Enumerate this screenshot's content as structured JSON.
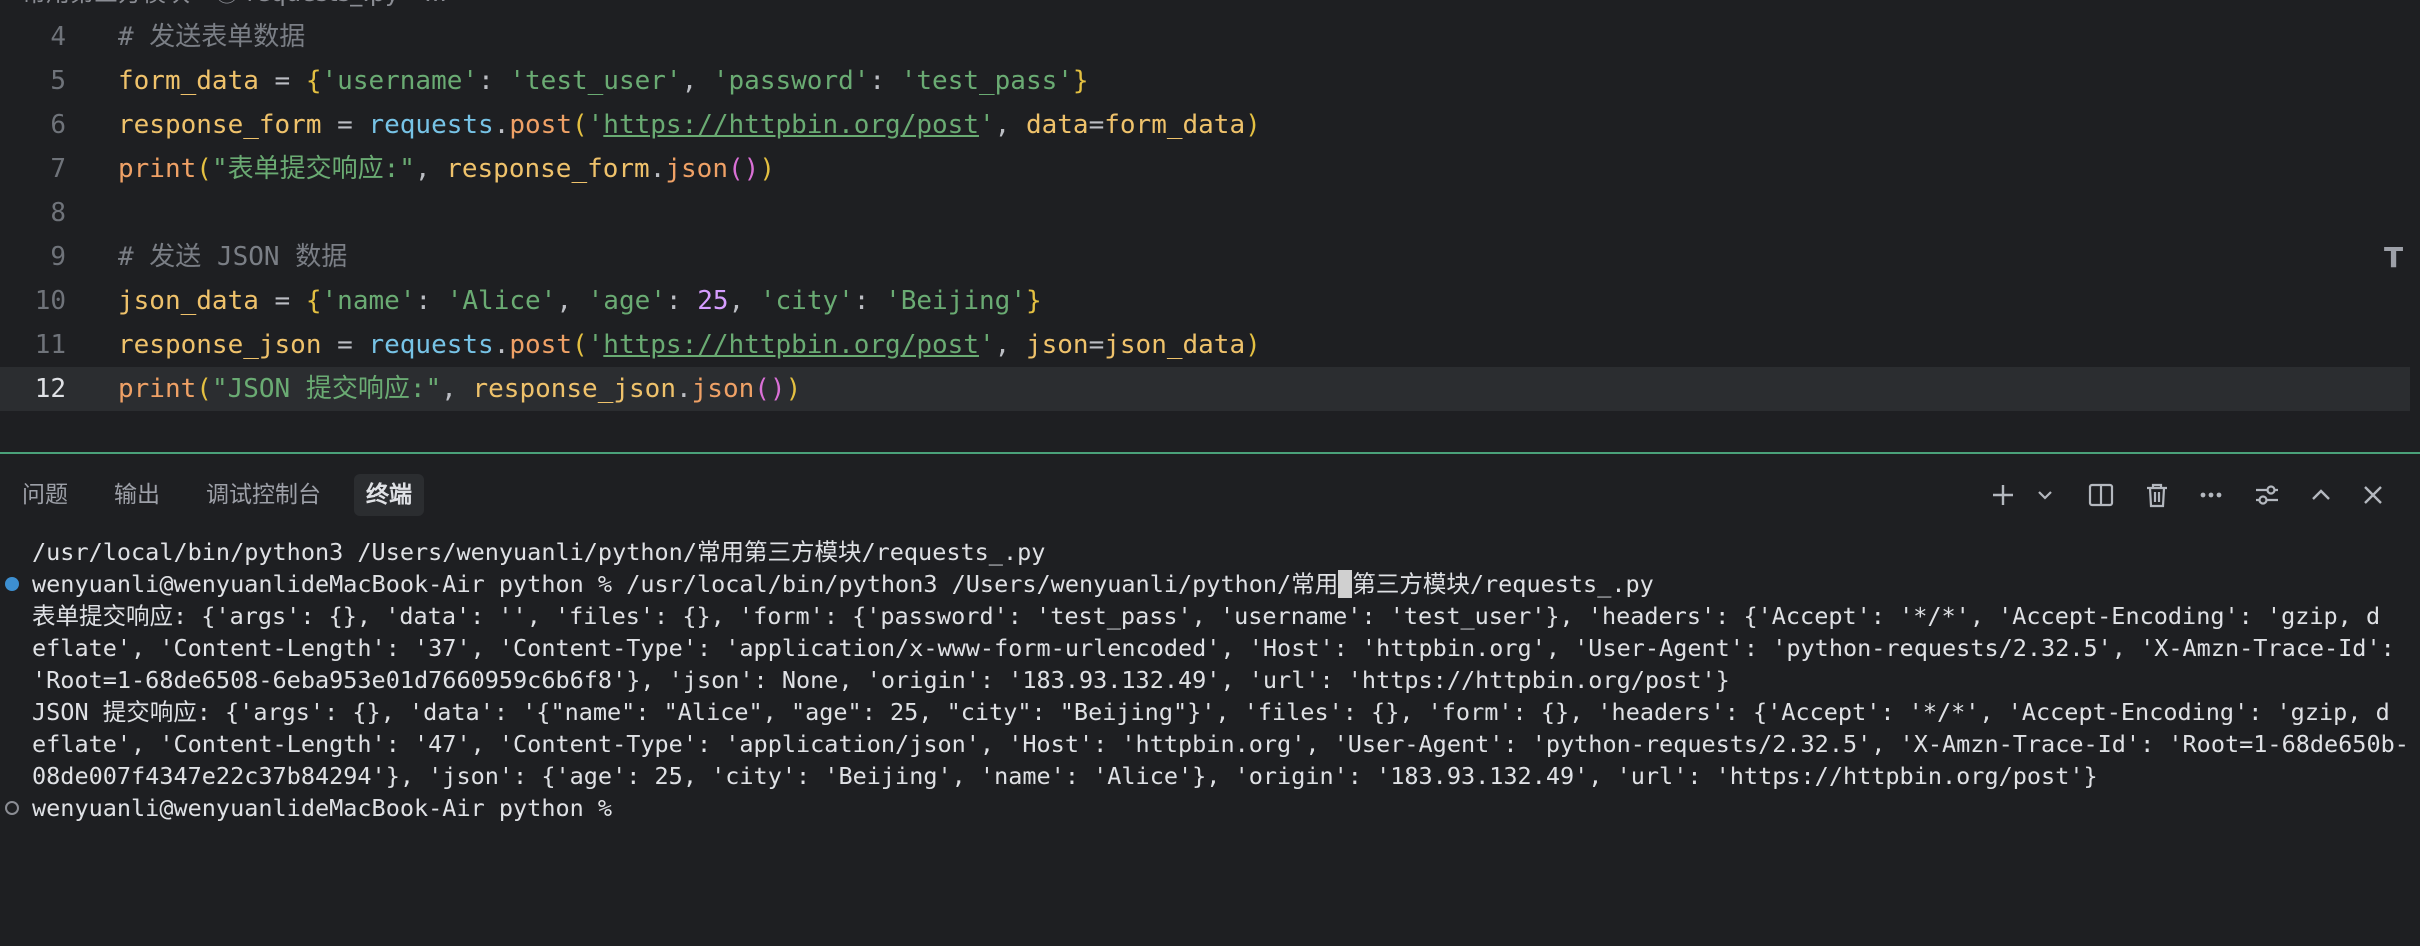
{
  "breadcrumb": "常用第三方模块 › ⓟ requests_.py › ...",
  "editor": {
    "lines": [
      {
        "num": "4",
        "tokens": [
          {
            "t": "# 发送表单数据",
            "c": "t-comment"
          }
        ]
      },
      {
        "num": "5",
        "tokens": [
          {
            "t": "form_data",
            "c": "t-var"
          },
          {
            "t": " = ",
            "c": "t-op"
          },
          {
            "t": "{",
            "c": "t-brace"
          },
          {
            "t": "'username'",
            "c": "t-str"
          },
          {
            "t": ": ",
            "c": "t-op"
          },
          {
            "t": "'test_user'",
            "c": "t-str"
          },
          {
            "t": ", ",
            "c": "t-op"
          },
          {
            "t": "'password'",
            "c": "t-str"
          },
          {
            "t": ": ",
            "c": "t-op"
          },
          {
            "t": "'test_pass'",
            "c": "t-str"
          },
          {
            "t": "}",
            "c": "t-brace"
          }
        ]
      },
      {
        "num": "6",
        "tokens": [
          {
            "t": "response_form",
            "c": "t-var"
          },
          {
            "t": " = ",
            "c": "t-op"
          },
          {
            "t": "requests",
            "c": "t-mod"
          },
          {
            "t": ".",
            "c": "t-op"
          },
          {
            "t": "post",
            "c": "t-method"
          },
          {
            "t": "(",
            "c": "t-brace"
          },
          {
            "t": "'",
            "c": "t-str"
          },
          {
            "t": "https://httpbin.org/post",
            "c": "t-url"
          },
          {
            "t": "'",
            "c": "t-str"
          },
          {
            "t": ", ",
            "c": "t-op"
          },
          {
            "t": "data",
            "c": "t-param"
          },
          {
            "t": "=",
            "c": "t-op"
          },
          {
            "t": "form_data",
            "c": "t-var"
          },
          {
            "t": ")",
            "c": "t-brace"
          }
        ]
      },
      {
        "num": "7",
        "tokens": [
          {
            "t": "print",
            "c": "t-func"
          },
          {
            "t": "(",
            "c": "t-brace"
          },
          {
            "t": "\"表单提交响应:\"",
            "c": "t-str"
          },
          {
            "t": ", ",
            "c": "t-op"
          },
          {
            "t": "response_form",
            "c": "t-var"
          },
          {
            "t": ".",
            "c": "t-op"
          },
          {
            "t": "json",
            "c": "t-method"
          },
          {
            "t": "()",
            "c": "t-brace2"
          },
          {
            "t": ")",
            "c": "t-brace"
          }
        ]
      },
      {
        "num": "8",
        "tokens": []
      },
      {
        "num": "9",
        "tokens": [
          {
            "t": "# 发送 JSON 数据",
            "c": "t-comment"
          }
        ]
      },
      {
        "num": "10",
        "tokens": [
          {
            "t": "json_data",
            "c": "t-var"
          },
          {
            "t": " = ",
            "c": "t-op"
          },
          {
            "t": "{",
            "c": "t-brace"
          },
          {
            "t": "'name'",
            "c": "t-str"
          },
          {
            "t": ": ",
            "c": "t-op"
          },
          {
            "t": "'Alice'",
            "c": "t-str"
          },
          {
            "t": ", ",
            "c": "t-op"
          },
          {
            "t": "'age'",
            "c": "t-str"
          },
          {
            "t": ": ",
            "c": "t-op"
          },
          {
            "t": "25",
            "c": "t-num"
          },
          {
            "t": ", ",
            "c": "t-op"
          },
          {
            "t": "'city'",
            "c": "t-str"
          },
          {
            "t": ": ",
            "c": "t-op"
          },
          {
            "t": "'Beijing'",
            "c": "t-str"
          },
          {
            "t": "}",
            "c": "t-brace"
          }
        ]
      },
      {
        "num": "11",
        "tokens": [
          {
            "t": "response_json",
            "c": "t-var"
          },
          {
            "t": " = ",
            "c": "t-op"
          },
          {
            "t": "requests",
            "c": "t-mod"
          },
          {
            "t": ".",
            "c": "t-op"
          },
          {
            "t": "post",
            "c": "t-method"
          },
          {
            "t": "(",
            "c": "t-brace"
          },
          {
            "t": "'",
            "c": "t-str"
          },
          {
            "t": "https://httpbin.org/post",
            "c": "t-url"
          },
          {
            "t": "'",
            "c": "t-str"
          },
          {
            "t": ", ",
            "c": "t-op"
          },
          {
            "t": "json",
            "c": "t-param"
          },
          {
            "t": "=",
            "c": "t-op"
          },
          {
            "t": "json_data",
            "c": "t-var"
          },
          {
            "t": ")",
            "c": "t-brace"
          }
        ]
      },
      {
        "num": "12",
        "current": true,
        "tokens": [
          {
            "t": "print",
            "c": "t-func"
          },
          {
            "t": "(",
            "c": "t-brace"
          },
          {
            "t": "\"JSON 提交响应:\"",
            "c": "t-str"
          },
          {
            "t": ", ",
            "c": "t-op"
          },
          {
            "t": "response_json",
            "c": "t-var"
          },
          {
            "t": ".",
            "c": "t-op"
          },
          {
            "t": "json",
            "c": "t-method"
          },
          {
            "t": "()",
            "c": "t-brace2"
          },
          {
            "t": ")",
            "c": "t-brace"
          }
        ]
      }
    ]
  },
  "panel": {
    "tabs": [
      {
        "label": "问题",
        "active": false
      },
      {
        "label": "输出",
        "active": false
      },
      {
        "label": "调试控制台",
        "active": false
      },
      {
        "label": "终端",
        "active": true
      }
    ],
    "toolbar_icons": [
      "plus-icon",
      "chevron-down-icon",
      "split-icon",
      "trash-icon",
      "more-icon",
      "settings-sliders-icon",
      "chevron-up-icon",
      "close-icon"
    ]
  },
  "terminal": {
    "lines": [
      {
        "dot": "",
        "text": "/usr/local/bin/python3 /Users/wenyuanli/python/常用第三方模块/requests_.py"
      },
      {
        "dot": "filled",
        "text_before_cursor": "wenyuanli@wenyuanlideMacBook-Air python % /usr/local/bin/python3 /Users/wenyuanli/python/常用",
        "cursor": " ",
        "text_after_cursor": "第三方模块/requests_.py"
      },
      {
        "dot": "",
        "text": "表单提交响应: {'args': {}, 'data': '', 'files': {}, 'form': {'password': 'test_pass', 'username': 'test_user'}, 'headers': {'Accept': '*/*', 'Accept-Encoding': 'gzip, d"
      },
      {
        "dot": "",
        "text": "eflate', 'Content-Length': '37', 'Content-Type': 'application/x-www-form-urlencoded', 'Host': 'httpbin.org', 'User-Agent': 'python-requests/2.32.5', 'X-Amzn-Trace-Id':"
      },
      {
        "dot": "",
        "text": "'Root=1-68de6508-6eba953e01d7660959c6b6f8'}, 'json': None, 'origin': '183.93.132.49', 'url': 'https://httpbin.org/post'}"
      },
      {
        "dot": "",
        "text": "JSON 提交响应: {'args': {}, 'data': '{\"name\": \"Alice\", \"age\": 25, \"city\": \"Beijing\"}', 'files': {}, 'form': {}, 'headers': {'Accept': '*/*', 'Accept-Encoding': 'gzip, d"
      },
      {
        "dot": "",
        "text": "eflate', 'Content-Length': '47', 'Content-Type': 'application/json', 'Host': 'httpbin.org', 'User-Agent': 'python-requests/2.32.5', 'X-Amzn-Trace-Id': 'Root=1-68de650b-"
      },
      {
        "dot": "",
        "text": "08de007f4347e22c37b84294'}, 'json': {'age': 25, 'city': 'Beijing', 'name': 'Alice'}, 'origin': '183.93.132.49', 'url': 'https://httpbin.org/post'}"
      },
      {
        "dot": "hollow",
        "text": "wenyuanli@wenyuanlideMacBook-Air python %"
      }
    ]
  }
}
